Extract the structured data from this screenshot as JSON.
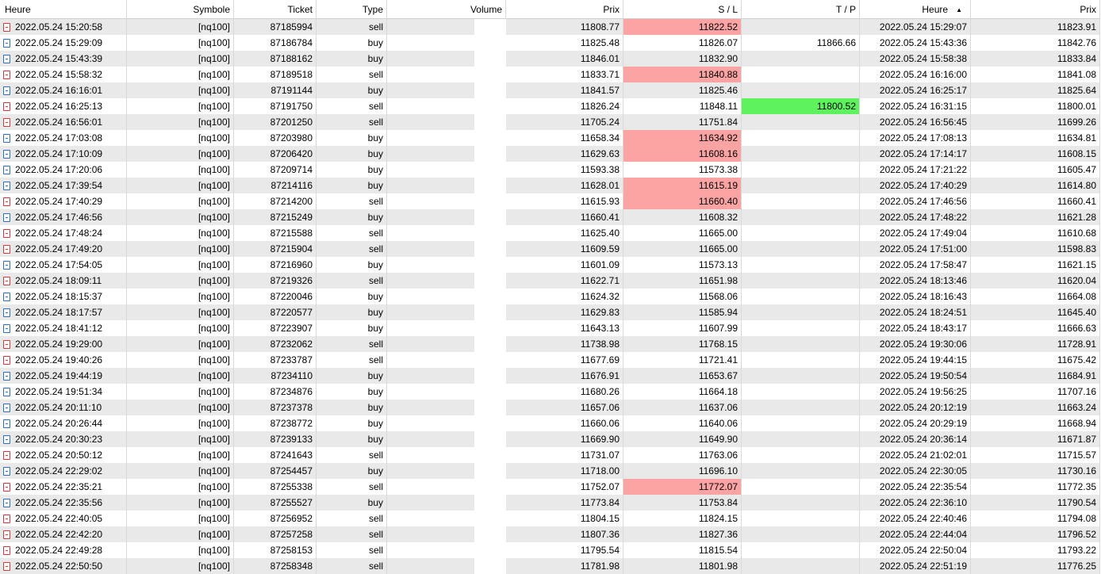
{
  "columns": [
    "Heure",
    "Symbole",
    "Ticket",
    "Type",
    "Volume",
    "Prix",
    "S / L",
    "T / P",
    "Heure",
    "Prix"
  ],
  "sort_indicator": "▲",
  "colors": {
    "sl_highlight": "#fca3a3",
    "tp_highlight": "#5ef25e",
    "row_stripe": "#e9e9e9"
  },
  "rows": [
    {
      "open_time": "2022.05.24 15:20:58",
      "symbol": "[nq100]",
      "ticket": "87185994",
      "type": "sell",
      "volume": "",
      "open_price": "11808.77",
      "sl": "11822.52",
      "tp": "",
      "close_time": "2022.05.24 15:29:07",
      "close_price": "11823.91",
      "sl_hit": true,
      "tp_hit": false
    },
    {
      "open_time": "2022.05.24 15:29:09",
      "symbol": "[nq100]",
      "ticket": "87186784",
      "type": "buy",
      "volume": "",
      "open_price": "11825.48",
      "sl": "11826.07",
      "tp": "11866.66",
      "close_time": "2022.05.24 15:43:36",
      "close_price": "11842.76",
      "sl_hit": false,
      "tp_hit": false
    },
    {
      "open_time": "2022.05.24 15:43:39",
      "symbol": "[nq100]",
      "ticket": "87188162",
      "type": "buy",
      "volume": "",
      "open_price": "11846.01",
      "sl": "11832.90",
      "tp": "",
      "close_time": "2022.05.24 15:58:38",
      "close_price": "11833.84",
      "sl_hit": false,
      "tp_hit": false
    },
    {
      "open_time": "2022.05.24 15:58:32",
      "symbol": "[nq100]",
      "ticket": "87189518",
      "type": "sell",
      "volume": "",
      "open_price": "11833.71",
      "sl": "11840.88",
      "tp": "",
      "close_time": "2022.05.24 16:16:00",
      "close_price": "11841.08",
      "sl_hit": true,
      "tp_hit": false
    },
    {
      "open_time": "2022.05.24 16:16:01",
      "symbol": "[nq100]",
      "ticket": "87191144",
      "type": "buy",
      "volume": "",
      "open_price": "11841.57",
      "sl": "11825.46",
      "tp": "",
      "close_time": "2022.05.24 16:25:17",
      "close_price": "11825.64",
      "sl_hit": false,
      "tp_hit": false
    },
    {
      "open_time": "2022.05.24 16:25:13",
      "symbol": "[nq100]",
      "ticket": "87191750",
      "type": "sell",
      "volume": "",
      "open_price": "11826.24",
      "sl": "11848.11",
      "tp": "11800.52",
      "close_time": "2022.05.24 16:31:15",
      "close_price": "11800.01",
      "sl_hit": false,
      "tp_hit": true
    },
    {
      "open_time": "2022.05.24 16:56:01",
      "symbol": "[nq100]",
      "ticket": "87201250",
      "type": "sell",
      "volume": "",
      "open_price": "11705.24",
      "sl": "11751.84",
      "tp": "",
      "close_time": "2022.05.24 16:56:45",
      "close_price": "11699.26",
      "sl_hit": false,
      "tp_hit": false
    },
    {
      "open_time": "2022.05.24 17:03:08",
      "symbol": "[nq100]",
      "ticket": "87203980",
      "type": "buy",
      "volume": "",
      "open_price": "11658.34",
      "sl": "11634.92",
      "tp": "",
      "close_time": "2022.05.24 17:08:13",
      "close_price": "11634.81",
      "sl_hit": true,
      "tp_hit": false
    },
    {
      "open_time": "2022.05.24 17:10:09",
      "symbol": "[nq100]",
      "ticket": "87206420",
      "type": "buy",
      "volume": "",
      "open_price": "11629.63",
      "sl": "11608.16",
      "tp": "",
      "close_time": "2022.05.24 17:14:17",
      "close_price": "11608.15",
      "sl_hit": true,
      "tp_hit": false
    },
    {
      "open_time": "2022.05.24 17:20:06",
      "symbol": "[nq100]",
      "ticket": "87209714",
      "type": "buy",
      "volume": "",
      "open_price": "11593.38",
      "sl": "11573.38",
      "tp": "",
      "close_time": "2022.05.24 17:21:22",
      "close_price": "11605.47",
      "sl_hit": false,
      "tp_hit": false
    },
    {
      "open_time": "2022.05.24 17:39:54",
      "symbol": "[nq100]",
      "ticket": "87214116",
      "type": "buy",
      "volume": "",
      "open_price": "11628.01",
      "sl": "11615.19",
      "tp": "",
      "close_time": "2022.05.24 17:40:29",
      "close_price": "11614.80",
      "sl_hit": true,
      "tp_hit": false
    },
    {
      "open_time": "2022.05.24 17:40:29",
      "symbol": "[nq100]",
      "ticket": "87214200",
      "type": "sell",
      "volume": "",
      "open_price": "11615.93",
      "sl": "11660.40",
      "tp": "",
      "close_time": "2022.05.24 17:46:56",
      "close_price": "11660.41",
      "sl_hit": true,
      "tp_hit": false
    },
    {
      "open_time": "2022.05.24 17:46:56",
      "symbol": "[nq100]",
      "ticket": "87215249",
      "type": "buy",
      "volume": "",
      "open_price": "11660.41",
      "sl": "11608.32",
      "tp": "",
      "close_time": "2022.05.24 17:48:22",
      "close_price": "11621.28",
      "sl_hit": false,
      "tp_hit": false
    },
    {
      "open_time": "2022.05.24 17:48:24",
      "symbol": "[nq100]",
      "ticket": "87215588",
      "type": "sell",
      "volume": "",
      "open_price": "11625.40",
      "sl": "11665.00",
      "tp": "",
      "close_time": "2022.05.24 17:49:04",
      "close_price": "11610.68",
      "sl_hit": false,
      "tp_hit": false
    },
    {
      "open_time": "2022.05.24 17:49:20",
      "symbol": "[nq100]",
      "ticket": "87215904",
      "type": "sell",
      "volume": "",
      "open_price": "11609.59",
      "sl": "11665.00",
      "tp": "",
      "close_time": "2022.05.24 17:51:00",
      "close_price": "11598.83",
      "sl_hit": false,
      "tp_hit": false
    },
    {
      "open_time": "2022.05.24 17:54:05",
      "symbol": "[nq100]",
      "ticket": "87216960",
      "type": "buy",
      "volume": "",
      "open_price": "11601.09",
      "sl": "11573.13",
      "tp": "",
      "close_time": "2022.05.24 17:58:47",
      "close_price": "11621.15",
      "sl_hit": false,
      "tp_hit": false
    },
    {
      "open_time": "2022.05.24 18:09:11",
      "symbol": "[nq100]",
      "ticket": "87219326",
      "type": "sell",
      "volume": "",
      "open_price": "11622.71",
      "sl": "11651.98",
      "tp": "",
      "close_time": "2022.05.24 18:13:46",
      "close_price": "11620.04",
      "sl_hit": false,
      "tp_hit": false
    },
    {
      "open_time": "2022.05.24 18:15:37",
      "symbol": "[nq100]",
      "ticket": "87220046",
      "type": "buy",
      "volume": "",
      "open_price": "11624.32",
      "sl": "11568.06",
      "tp": "",
      "close_time": "2022.05.24 18:16:43",
      "close_price": "11664.08",
      "sl_hit": false,
      "tp_hit": false
    },
    {
      "open_time": "2022.05.24 18:17:57",
      "symbol": "[nq100]",
      "ticket": "87220577",
      "type": "buy",
      "volume": "",
      "open_price": "11629.83",
      "sl": "11585.94",
      "tp": "",
      "close_time": "2022.05.24 18:24:51",
      "close_price": "11645.40",
      "sl_hit": false,
      "tp_hit": false
    },
    {
      "open_time": "2022.05.24 18:41:12",
      "symbol": "[nq100]",
      "ticket": "87223907",
      "type": "buy",
      "volume": "",
      "open_price": "11643.13",
      "sl": "11607.99",
      "tp": "",
      "close_time": "2022.05.24 18:43:17",
      "close_price": "11666.63",
      "sl_hit": false,
      "tp_hit": false
    },
    {
      "open_time": "2022.05.24 19:29:00",
      "symbol": "[nq100]",
      "ticket": "87232062",
      "type": "sell",
      "volume": "",
      "open_price": "11738.98",
      "sl": "11768.15",
      "tp": "",
      "close_time": "2022.05.24 19:30:06",
      "close_price": "11728.91",
      "sl_hit": false,
      "tp_hit": false
    },
    {
      "open_time": "2022.05.24 19:40:26",
      "symbol": "[nq100]",
      "ticket": "87233787",
      "type": "sell",
      "volume": "",
      "open_price": "11677.69",
      "sl": "11721.41",
      "tp": "",
      "close_time": "2022.05.24 19:44:15",
      "close_price": "11675.42",
      "sl_hit": false,
      "tp_hit": false
    },
    {
      "open_time": "2022.05.24 19:44:19",
      "symbol": "[nq100]",
      "ticket": "87234110",
      "type": "buy",
      "volume": "",
      "open_price": "11676.91",
      "sl": "11653.67",
      "tp": "",
      "close_time": "2022.05.24 19:50:54",
      "close_price": "11684.91",
      "sl_hit": false,
      "tp_hit": false
    },
    {
      "open_time": "2022.05.24 19:51:34",
      "symbol": "[nq100]",
      "ticket": "87234876",
      "type": "buy",
      "volume": "",
      "open_price": "11680.26",
      "sl": "11664.18",
      "tp": "",
      "close_time": "2022.05.24 19:56:25",
      "close_price": "11707.16",
      "sl_hit": false,
      "tp_hit": false
    },
    {
      "open_time": "2022.05.24 20:11:10",
      "symbol": "[nq100]",
      "ticket": "87237378",
      "type": "buy",
      "volume": "",
      "open_price": "11657.06",
      "sl": "11637.06",
      "tp": "",
      "close_time": "2022.05.24 20:12:19",
      "close_price": "11663.24",
      "sl_hit": false,
      "tp_hit": false
    },
    {
      "open_time": "2022.05.24 20:26:44",
      "symbol": "[nq100]",
      "ticket": "87238772",
      "type": "buy",
      "volume": "",
      "open_price": "11660.06",
      "sl": "11640.06",
      "tp": "",
      "close_time": "2022.05.24 20:29:19",
      "close_price": "11668.94",
      "sl_hit": false,
      "tp_hit": false
    },
    {
      "open_time": "2022.05.24 20:30:23",
      "symbol": "[nq100]",
      "ticket": "87239133",
      "type": "buy",
      "volume": "",
      "open_price": "11669.90",
      "sl": "11649.90",
      "tp": "",
      "close_time": "2022.05.24 20:36:14",
      "close_price": "11671.87",
      "sl_hit": false,
      "tp_hit": false
    },
    {
      "open_time": "2022.05.24 20:50:12",
      "symbol": "[nq100]",
      "ticket": "87241643",
      "type": "sell",
      "volume": "",
      "open_price": "11731.07",
      "sl": "11763.06",
      "tp": "",
      "close_time": "2022.05.24 21:02:01",
      "close_price": "11715.57",
      "sl_hit": false,
      "tp_hit": false
    },
    {
      "open_time": "2022.05.24 22:29:02",
      "symbol": "[nq100]",
      "ticket": "87254457",
      "type": "buy",
      "volume": "",
      "open_price": "11718.00",
      "sl": "11696.10",
      "tp": "",
      "close_time": "2022.05.24 22:30:05",
      "close_price": "11730.16",
      "sl_hit": false,
      "tp_hit": false
    },
    {
      "open_time": "2022.05.24 22:35:21",
      "symbol": "[nq100]",
      "ticket": "87255338",
      "type": "sell",
      "volume": "",
      "open_price": "11752.07",
      "sl": "11772.07",
      "tp": "",
      "close_time": "2022.05.24 22:35:54",
      "close_price": "11772.35",
      "sl_hit": true,
      "tp_hit": false
    },
    {
      "open_time": "2022.05.24 22:35:56",
      "symbol": "[nq100]",
      "ticket": "87255527",
      "type": "buy",
      "volume": "",
      "open_price": "11773.84",
      "sl": "11753.84",
      "tp": "",
      "close_time": "2022.05.24 22:36:10",
      "close_price": "11790.54",
      "sl_hit": false,
      "tp_hit": false
    },
    {
      "open_time": "2022.05.24 22:40:05",
      "symbol": "[nq100]",
      "ticket": "87256952",
      "type": "sell",
      "volume": "",
      "open_price": "11804.15",
      "sl": "11824.15",
      "tp": "",
      "close_time": "2022.05.24 22:40:46",
      "close_price": "11794.08",
      "sl_hit": false,
      "tp_hit": false
    },
    {
      "open_time": "2022.05.24 22:42:20",
      "symbol": "[nq100]",
      "ticket": "87257258",
      "type": "sell",
      "volume": "",
      "open_price": "11807.36",
      "sl": "11827.36",
      "tp": "",
      "close_time": "2022.05.24 22:44:04",
      "close_price": "11796.52",
      "sl_hit": false,
      "tp_hit": false
    },
    {
      "open_time": "2022.05.24 22:49:28",
      "symbol": "[nq100]",
      "ticket": "87258153",
      "type": "sell",
      "volume": "",
      "open_price": "11795.54",
      "sl": "11815.54",
      "tp": "",
      "close_time": "2022.05.24 22:50:04",
      "close_price": "11793.22",
      "sl_hit": false,
      "tp_hit": false
    },
    {
      "open_time": "2022.05.24 22:50:50",
      "symbol": "[nq100]",
      "ticket": "87258348",
      "type": "sell",
      "volume": "",
      "open_price": "11781.98",
      "sl": "11801.98",
      "tp": "",
      "close_time": "2022.05.24 22:51:19",
      "close_price": "11776.25",
      "sl_hit": false,
      "tp_hit": false
    }
  ]
}
